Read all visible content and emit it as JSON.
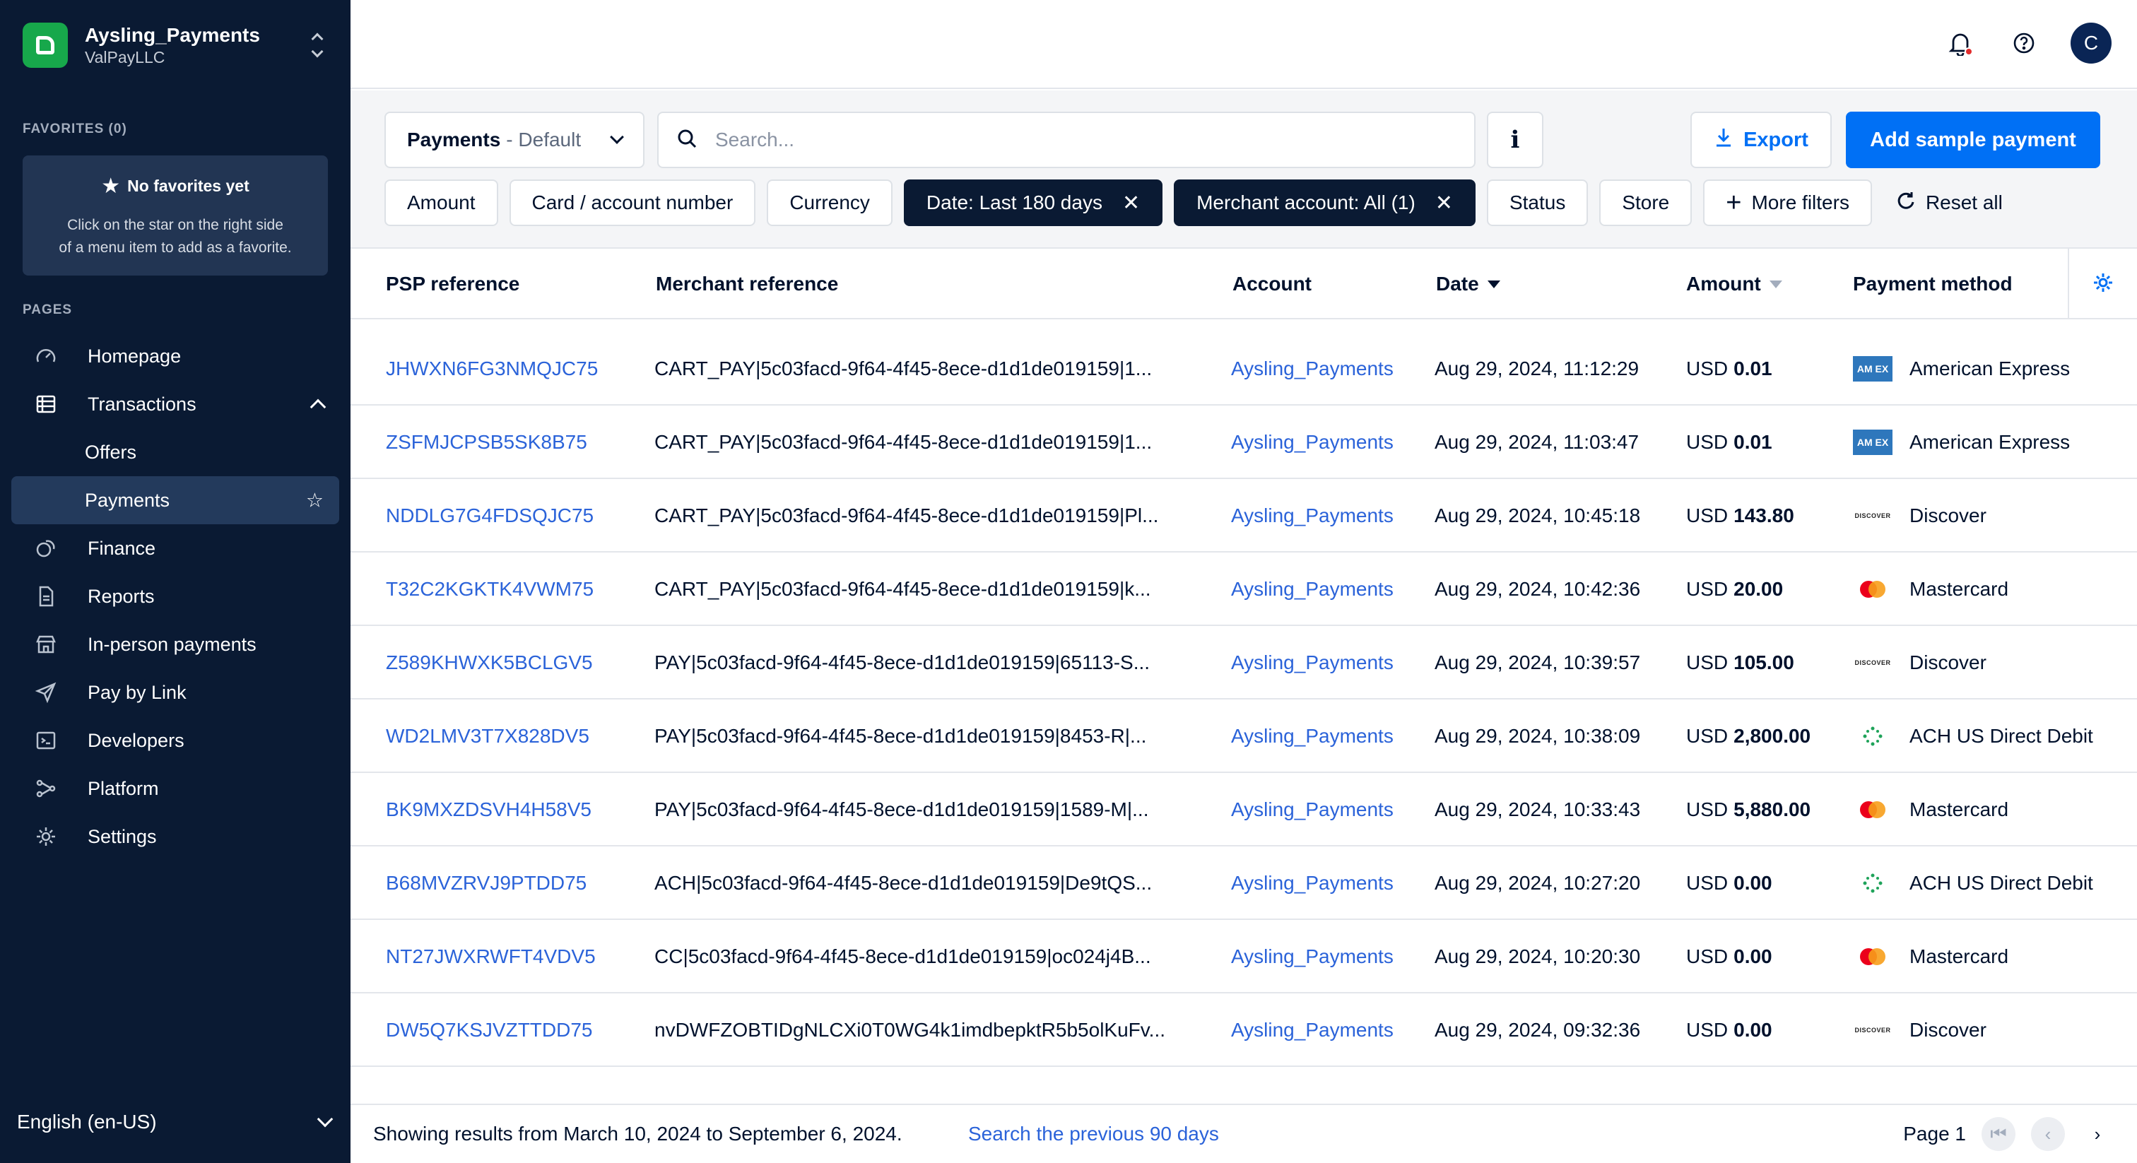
{
  "account": {
    "name": "Aysling_Payments",
    "company": "ValPayLLC"
  },
  "favorites": {
    "label": "FAVORITES (0)",
    "empty_title": "No favorites yet",
    "empty_line1": "Click on the star on the right side",
    "empty_line2": "of a menu item to add as a favorite."
  },
  "pages_label": "PAGES",
  "nav": {
    "homepage": "Homepage",
    "transactions": "Transactions",
    "offers": "Offers",
    "payments": "Payments",
    "finance": "Finance",
    "reports": "Reports",
    "in_person": "In-person payments",
    "pay_by_link": "Pay by Link",
    "developers": "Developers",
    "platform": "Platform",
    "settings": "Settings"
  },
  "language": "English (en-US)",
  "header": {
    "avatar_initial": "C"
  },
  "toolbar": {
    "view_name": "Payments",
    "view_variant": "- Default",
    "search_placeholder": "Search...",
    "info_glyph": "i",
    "export_label": "Export",
    "add_label": "Add sample payment"
  },
  "filters": {
    "amount": "Amount",
    "card": "Card / account number",
    "currency": "Currency",
    "date": "Date: Last 180 days",
    "merchant": "Merchant account: All (1)",
    "status": "Status",
    "store": "Store",
    "more": "More filters",
    "reset": "Reset all"
  },
  "columns": {
    "psp": "PSP reference",
    "merchant_ref": "Merchant reference",
    "account": "Account",
    "date": "Date",
    "amount": "Amount",
    "method": "Payment method"
  },
  "rows": [
    {
      "psp": "JHWXN6FG3NMQJC75",
      "ref": "CART_PAY|5c03facd-9f64-4f45-8ece-d1d1de019159|1...",
      "account": "Aysling_Payments",
      "date": "Aug 29, 2024, 11:12:29",
      "currency": "USD",
      "amount": "0.01",
      "method": "American Express",
      "logo": "amex"
    },
    {
      "psp": "ZSFMJCPSB5SK8B75",
      "ref": "CART_PAY|5c03facd-9f64-4f45-8ece-d1d1de019159|1...",
      "account": "Aysling_Payments",
      "date": "Aug 29, 2024, 11:03:47",
      "currency": "USD",
      "amount": "0.01",
      "method": "American Express",
      "logo": "amex"
    },
    {
      "psp": "NDDLG7G4FDSQJC75",
      "ref": "CART_PAY|5c03facd-9f64-4f45-8ece-d1d1de019159|Pl...",
      "account": "Aysling_Payments",
      "date": "Aug 29, 2024, 10:45:18",
      "currency": "USD",
      "amount": "143.80",
      "method": "Discover",
      "logo": "discover"
    },
    {
      "psp": "T32C2KGKTK4VWM75",
      "ref": "CART_PAY|5c03facd-9f64-4f45-8ece-d1d1de019159|k...",
      "account": "Aysling_Payments",
      "date": "Aug 29, 2024, 10:42:36",
      "currency": "USD",
      "amount": "20.00",
      "method": "Mastercard",
      "logo": "mc"
    },
    {
      "psp": "Z589KHWXK5BCLGV5",
      "ref": "PAY|5c03facd-9f64-4f45-8ece-d1d1de019159|65113-S...",
      "account": "Aysling_Payments",
      "date": "Aug 29, 2024, 10:39:57",
      "currency": "USD",
      "amount": "105.00",
      "method": "Discover",
      "logo": "discover"
    },
    {
      "psp": "WD2LMV3T7X828DV5",
      "ref": "PAY|5c03facd-9f64-4f45-8ece-d1d1de019159|8453-R|...",
      "account": "Aysling_Payments",
      "date": "Aug 29, 2024, 10:38:09",
      "currency": "USD",
      "amount": "2,800.00",
      "method": "ACH US Direct Debit",
      "logo": "ach"
    },
    {
      "psp": "BK9MXZDSVH4H58V5",
      "ref": "PAY|5c03facd-9f64-4f45-8ece-d1d1de019159|1589-M|...",
      "account": "Aysling_Payments",
      "date": "Aug 29, 2024, 10:33:43",
      "currency": "USD",
      "amount": "5,880.00",
      "method": "Mastercard",
      "logo": "mc"
    },
    {
      "psp": "B68MVZRVJ9PTDD75",
      "ref": "ACH|5c03facd-9f64-4f45-8ece-d1d1de019159|De9tQS...",
      "account": "Aysling_Payments",
      "date": "Aug 29, 2024, 10:27:20",
      "currency": "USD",
      "amount": "0.00",
      "method": "ACH US Direct Debit",
      "logo": "ach"
    },
    {
      "psp": "NT27JWXRWFT4VDV5",
      "ref": "CC|5c03facd-9f64-4f45-8ece-d1d1de019159|oc024j4B...",
      "account": "Aysling_Payments",
      "date": "Aug 29, 2024, 10:20:30",
      "currency": "USD",
      "amount": "0.00",
      "method": "Mastercard",
      "logo": "mc"
    },
    {
      "psp": "DW5Q7KSJVZTTDD75",
      "ref": "nvDWFZOBTIDgNLCXi0T0WG4k1imdbepktR5b5olKuFv...",
      "account": "Aysling_Payments",
      "date": "Aug 29, 2024, 09:32:36",
      "currency": "USD",
      "amount": "0.00",
      "method": "Discover",
      "logo": "discover"
    }
  ],
  "footer": {
    "message": "Showing results from March 10, 2024 to September 6, 2024.",
    "prev_link": "Search the previous 90 days",
    "page_label": "Page 1"
  },
  "logo_text": {
    "amex": "AM EX",
    "discover": "DISCOVER"
  },
  "colors": {
    "primary": "#0070f5",
    "sidebar": "#0a1a33",
    "link": "#2b63d9",
    "brand_green": "#17a84b"
  }
}
